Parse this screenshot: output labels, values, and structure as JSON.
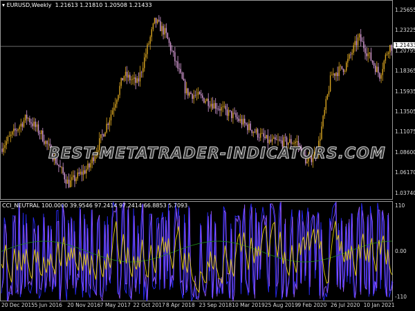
{
  "header": {
    "symbol": "EURUSD,Weekly",
    "ohlc": "1.21613 1.21810 1.20508 1.21433"
  },
  "indicator": {
    "title": "CCI_NEUTRAL 100.0000 39.9546 97.2414 97.2414 66.8853 5.7093",
    "levels": [
      "110",
      "0.00",
      "-110"
    ]
  },
  "price_axis": [
    "1.25655",
    "1.23225",
    "1.20795",
    "1.18365",
    "1.15935",
    "1.13505",
    "1.11075",
    "1.08600",
    "1.06170",
    "1.03740"
  ],
  "current_price": "1.21433",
  "time_axis": [
    "20 Dec 2015",
    "5 Jun 2016",
    "20 Nov 2016",
    "7 May 2017",
    "22 Oct 2017",
    "8 Apr 2018",
    "23 Sep 2018",
    "10 Mar 2019",
    "25 Aug 2019",
    "9 Feb 2020",
    "26 Jul 2020",
    "10 Jan 2021"
  ],
  "watermark": "BEST-METATRADER-INDICATORS.COM",
  "colors": {
    "up": "#daa520",
    "down": "#dda0dd",
    "cci": "#2a2aff",
    "cci2": "#9a5cff",
    "signal": "#e6d200",
    "ma": "#1f8a1f"
  },
  "chart_data": {
    "type": "candlestick",
    "price_path": [
      [
        0,
        1.09
      ],
      [
        40,
        1.13
      ],
      [
        60,
        1.11
      ],
      [
        100,
        1.05
      ],
      [
        130,
        1.07
      ],
      [
        160,
        1.13
      ],
      [
        180,
        1.18
      ],
      [
        200,
        1.17
      ],
      [
        225,
        1.245
      ],
      [
        240,
        1.23
      ],
      [
        270,
        1.16
      ],
      [
        300,
        1.15
      ],
      [
        340,
        1.13
      ],
      [
        390,
        1.1
      ],
      [
        430,
        1.1
      ],
      [
        445,
        1.075
      ],
      [
        460,
        1.09
      ],
      [
        480,
        1.18
      ],
      [
        500,
        1.19
      ],
      [
        520,
        1.225
      ],
      [
        550,
        1.18
      ],
      [
        563,
        1.214
      ]
    ],
    "ylim": [
      1.025,
      1.265
    ],
    "cci_range": [
      -110,
      110
    ]
  }
}
